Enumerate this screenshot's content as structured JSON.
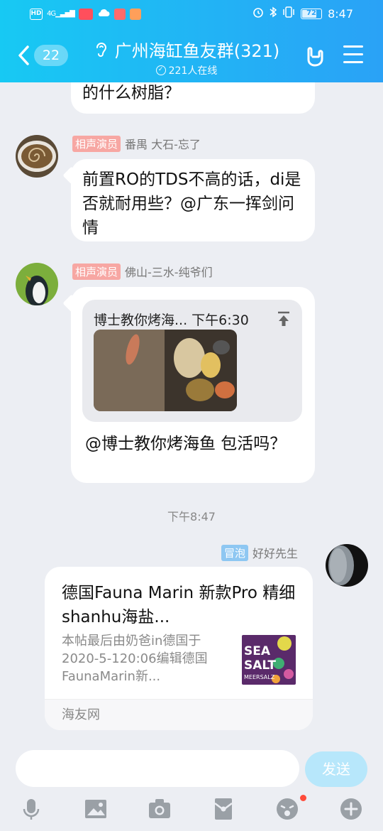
{
  "status_bar": {
    "left_icons": [
      "hd-icon",
      "4g-signal-icon",
      "wifi-signal-icon",
      "app-notification-icon",
      "cloud-icon",
      "reader-icon",
      "app-icon"
    ],
    "right_icons": [
      "alarm-icon",
      "bluetooth-icon",
      "vibrate-icon"
    ],
    "battery": "72",
    "time": "8:47"
  },
  "header": {
    "unread_count": "22",
    "title": "广州海缸鱼友群(321)",
    "online_text": "221人在线"
  },
  "messages": [
    {
      "text": "的什么树脂？"
    },
    {
      "tag": "相声演员",
      "sender": "番禺 大石-忘了",
      "text": "前置RO的TDS不高的话，di是否就耐用些？@广东一挥剑问情"
    },
    {
      "tag": "相声演员",
      "sender": "佛山-三水-纯爷们",
      "quote_header": "博士教你烤海... 下午6:30",
      "text": "@博士教你烤海鱼 包活吗？"
    }
  ],
  "time_divider": "下午8:47",
  "share": {
    "tag": "冒泡",
    "sender": "好好先生",
    "title": "德国Fauna Marin 新款Pro 精细shanhu海盐...",
    "description": "本帖最后由奶爸in德国于2020-5-120:06编辑德国FaunaMarin新...",
    "source": "海友网",
    "thumb_text": "SEA SALT MEERSALZ"
  },
  "input": {
    "placeholder": "",
    "send_label": "发送"
  },
  "toolbar": [
    "microphone-icon",
    "image-icon",
    "camera-icon",
    "red-packet-icon",
    "emoji-icon",
    "plus-icon"
  ],
  "colors": {
    "header_gradient_start": "#17c9f3",
    "header_gradient_end": "#2aa2f6",
    "chat_background": "#eceef3",
    "tag_red": "#f7a7a3",
    "tag_blue": "#8ec7f2",
    "send_button": "#b7e7fb",
    "badge_dot": "#ff4b3a"
  }
}
